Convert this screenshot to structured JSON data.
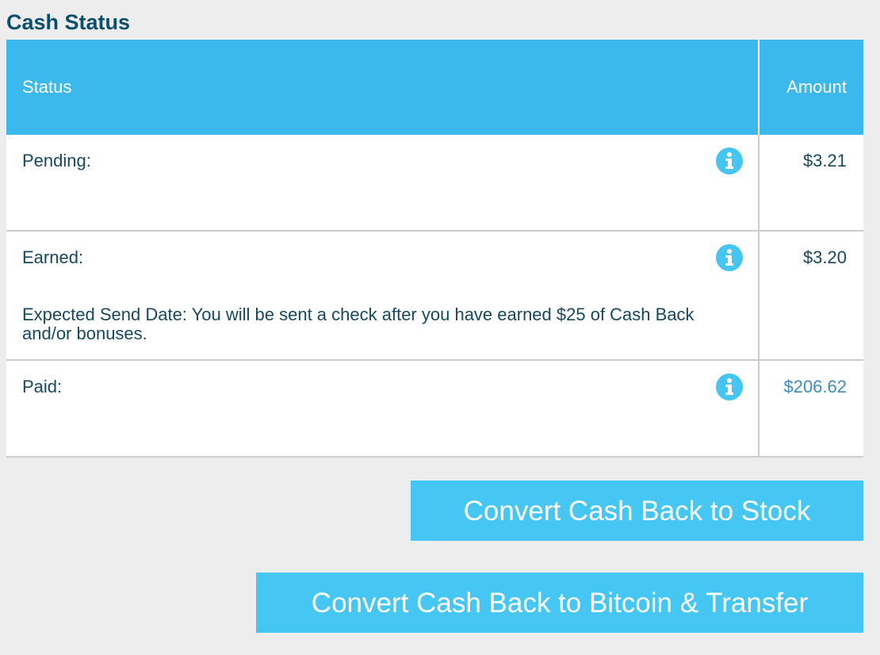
{
  "title": "Cash Status",
  "table": {
    "headers": {
      "status": "Status",
      "amount": "Amount"
    },
    "rows": [
      {
        "label": "Pending:",
        "amount": "$3.21",
        "icon": "info-icon"
      },
      {
        "label": "Earned:",
        "amount": "$3.20",
        "note": "Expected Send Date: You will be sent a check after you have earned $25 of Cash Back and/or bonuses.",
        "icon": "info-icon"
      },
      {
        "label": "Paid:",
        "amount": "$206.62",
        "icon": "info-icon"
      }
    ]
  },
  "buttons": {
    "stock": "Convert Cash Back to Stock",
    "bitcoin": "Convert Cash Back to Bitcoin & Transfer"
  },
  "colors": {
    "header_bg": "#3bb8ec",
    "button_bg": "#45c6f3",
    "title": "#0b4f6f",
    "text": "#17485f",
    "link_amount": "#3d8bbd",
    "info_icon": "#46c4f2",
    "page_bg": "#ededed"
  }
}
